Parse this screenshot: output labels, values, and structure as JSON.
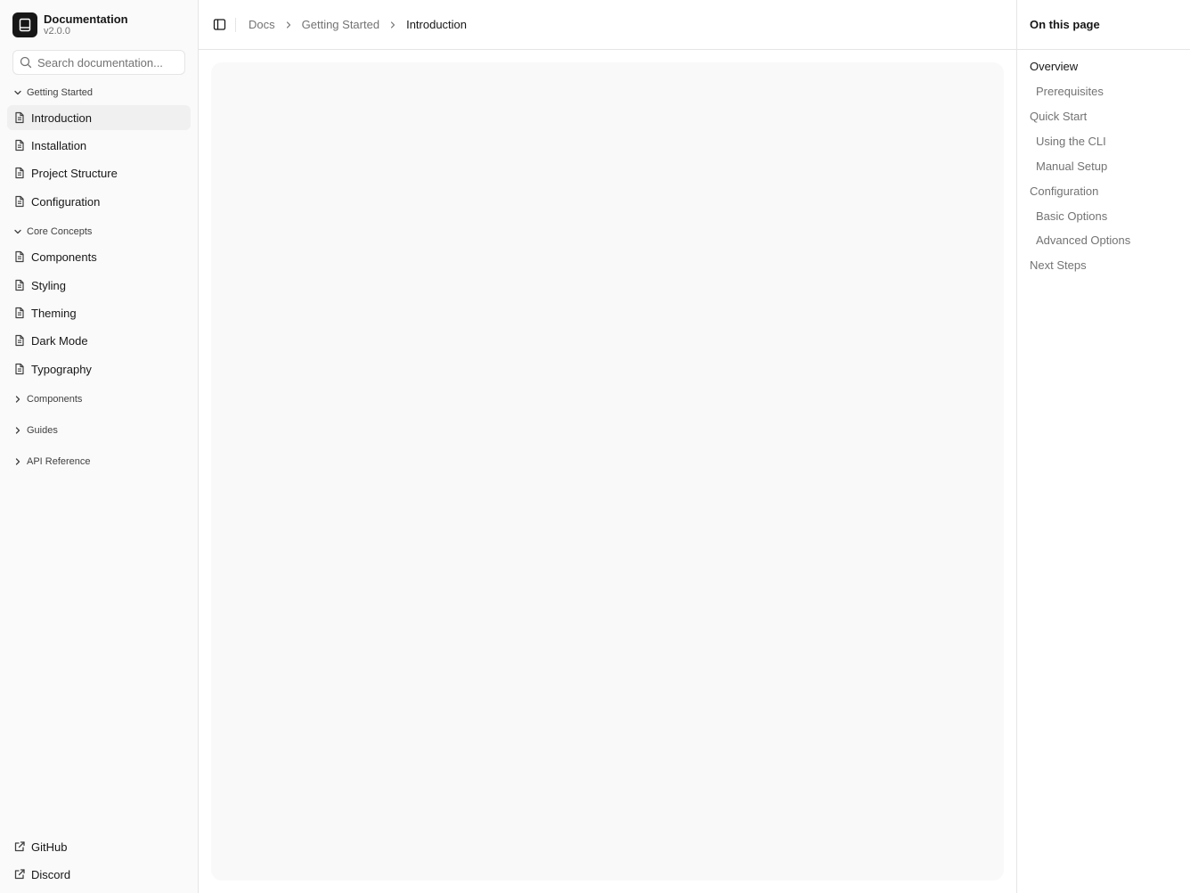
{
  "brand": {
    "title": "Documentation",
    "version": "v2.0.0"
  },
  "search": {
    "placeholder": "Search documentation..."
  },
  "sidebar": {
    "groups": [
      {
        "label": "Getting Started",
        "expanded": true,
        "items": [
          {
            "label": "Introduction",
            "active": true
          },
          {
            "label": "Installation"
          },
          {
            "label": "Project Structure"
          },
          {
            "label": "Configuration"
          }
        ]
      },
      {
        "label": "Core Concepts",
        "expanded": true,
        "items": [
          {
            "label": "Components"
          },
          {
            "label": "Styling"
          },
          {
            "label": "Theming"
          },
          {
            "label": "Dark Mode"
          },
          {
            "label": "Typography"
          }
        ]
      },
      {
        "label": "Components",
        "expanded": false
      },
      {
        "label": "Guides",
        "expanded": false
      },
      {
        "label": "API Reference",
        "expanded": false
      }
    ],
    "footer": [
      {
        "label": "GitHub"
      },
      {
        "label": "Discord"
      }
    ]
  },
  "breadcrumb": [
    "Docs",
    "Getting Started",
    "Introduction"
  ],
  "toc": {
    "title": "On this page",
    "items": [
      {
        "label": "Overview",
        "level": 1,
        "active": true
      },
      {
        "label": "Prerequisites",
        "level": 2
      },
      {
        "label": "Quick Start",
        "level": 1
      },
      {
        "label": "Using the CLI",
        "level": 2
      },
      {
        "label": "Manual Setup",
        "level": 2
      },
      {
        "label": "Configuration",
        "level": 1
      },
      {
        "label": "Basic Options",
        "level": 2
      },
      {
        "label": "Advanced Options",
        "level": 2
      },
      {
        "label": "Next Steps",
        "level": 1
      }
    ]
  },
  "colors": {
    "text": "#171717",
    "muted": "#737373",
    "border": "#e5e5e5",
    "sidebar_bg": "#fafafa",
    "active_bg": "#f0f0f0"
  }
}
